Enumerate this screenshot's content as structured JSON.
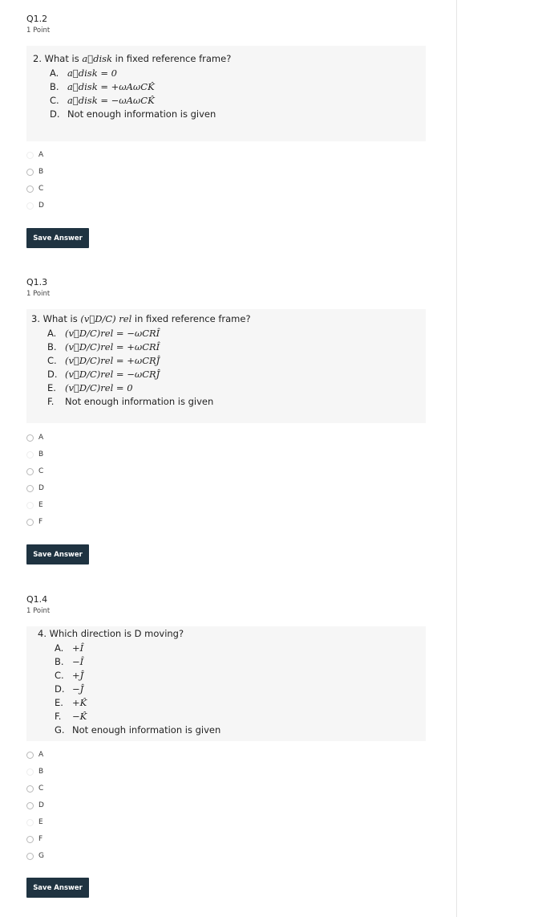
{
  "questions": [
    {
      "title": "Q1.2",
      "points": "1 Point",
      "prompt_pre": "2.  What is ",
      "prompt_post": " in fixed reference frame?",
      "options": [
        {
          "label": "A.",
          "text": "a⃗disk = 0"
        },
        {
          "label": "B.",
          "text": "a⃗disk = +ωAωCK̂"
        },
        {
          "label": "C.",
          "text": "a⃗disk = −ωAωCK̂"
        },
        {
          "label": "D.",
          "text": "Not enough information is given"
        }
      ],
      "choices": [
        "A",
        "B",
        "C",
        "D"
      ],
      "save_label": "Save Answer"
    },
    {
      "title": "Q1.3",
      "points": "1 Point",
      "prompt_pre": "3.  What is ",
      "prompt_post": " in fixed reference frame?",
      "options": [
        {
          "label": "A.",
          "text": "(v⃗D/C)rel = −ωCRÎ"
        },
        {
          "label": "B.",
          "text": "(v⃗D/C)rel = +ωCRÎ"
        },
        {
          "label": "C.",
          "text": "(v⃗D/C)rel = +ωCRĴ"
        },
        {
          "label": "D.",
          "text": "(v⃗D/C)rel = −ωCRĴ"
        },
        {
          "label": "E.",
          "text": "(v⃗D/C)rel = 0"
        },
        {
          "label": "F.",
          "text": "Not enough information is given"
        }
      ],
      "choices": [
        "A",
        "B",
        "C",
        "D",
        "E",
        "F"
      ],
      "save_label": "Save Answer"
    },
    {
      "title": "Q1.4",
      "points": "1 Point",
      "prompt": "4.  Which direction is D moving?",
      "options": [
        {
          "label": "A.",
          "text": "+Î"
        },
        {
          "label": "B.",
          "text": "−Î"
        },
        {
          "label": "C.",
          "text": "+Ĵ"
        },
        {
          "label": "D.",
          "text": "−Ĵ"
        },
        {
          "label": "E.",
          "text": "+K̂"
        },
        {
          "label": "F.",
          "text": "−K̂"
        },
        {
          "label": "G.",
          "text": "Not enough information is given"
        }
      ],
      "choices": [
        "A",
        "B",
        "C",
        "D",
        "E",
        "F",
        "G"
      ],
      "save_label": "Save Answer"
    }
  ],
  "math": {
    "a_disk": "a⃗disk",
    "v_dc_rel": "(v⃗D/C) rel"
  }
}
